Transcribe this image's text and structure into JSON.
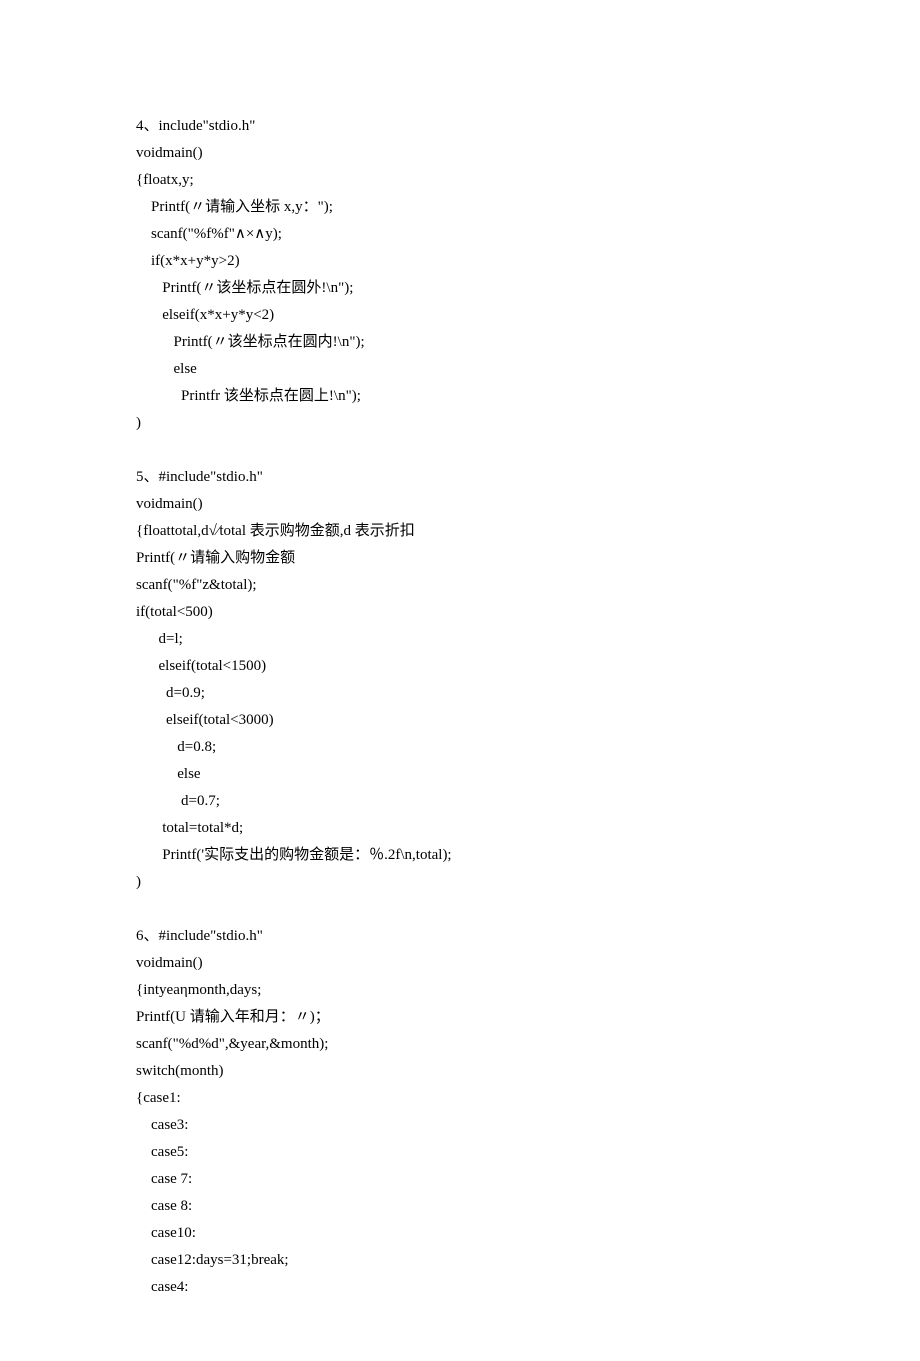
{
  "lines": [
    "4、include\"stdio.h\"",
    "voidmain()",
    "{floatx,y;",
    "    Printf(〃请输入坐标 x,y：\");",
    "    scanf(\"%f%f\"∧×∧y);",
    "    if(x*x+y*y>2)",
    "       Printf(〃该坐标点在圆外!\\n\");",
    "       elseif(x*x+y*y<2)",
    "          Printf(〃该坐标点在圆内!\\n\");",
    "          else",
    "            Printfr 该坐标点在圆上!\\n\");",
    ")",
    "",
    "5、#include\"stdio.h\"",
    "voidmain()",
    "{floattotal,d√∕total 表示购物金额,d 表示折扣",
    "Printf(〃请输入购物金额",
    "scanf(\"%f\"z&total);",
    "if(total<500)",
    "      d=l;",
    "      elseif(total<1500)",
    "        d=0.9;",
    "        elseif(total<3000)",
    "           d=0.8;",
    "           else",
    "            d=0.7;",
    "       total=total*d;",
    "       Printf('实际支出的购物金额是：％.2f\\n,total);",
    ")",
    "",
    "6、#include\"stdio.h\"",
    "voidmain()",
    "{intyeaηmonth,days;",
    "Printf(U 请输入年和月：〃)；",
    "scanf(\"%d%d\",&year,&month);",
    "switch(month)",
    "{case1:",
    "    case3:",
    "    case5:",
    "    case 7:",
    "    case 8:",
    "    case10:",
    "    case12:days=31;break;",
    "    case4:"
  ]
}
